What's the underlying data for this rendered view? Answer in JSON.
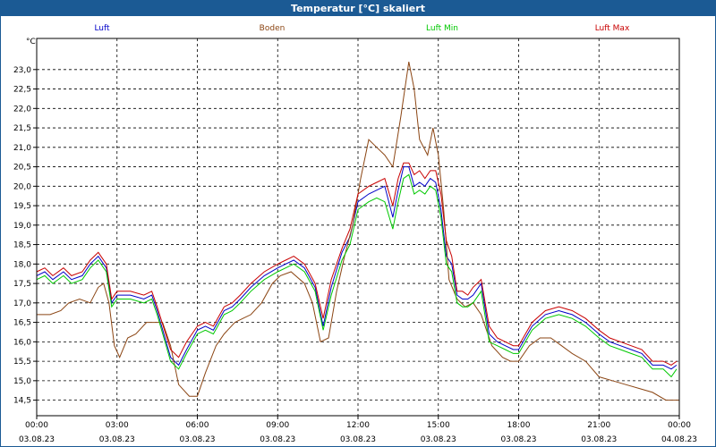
{
  "window": {
    "title": "Temperatur [°C] skaliert"
  },
  "colors": {
    "title_bg": "#1b5a94",
    "grid": "#000000"
  },
  "chart_data": {
    "type": "line",
    "title": "Temperatur [°C] skaliert",
    "ylabel": "°C",
    "ylim": [
      14.1,
      23.8
    ],
    "xlim": [
      "2023-08-03T00:00",
      "2023-08-04T00:00"
    ],
    "yticks": [
      "23,0",
      "22,5",
      "22,0",
      "21,5",
      "21,0",
      "20,5",
      "20,0",
      "19,5",
      "19,0",
      "18,5",
      "18,0",
      "17,5",
      "17,0",
      "16,5",
      "16,0",
      "15,5",
      "15,0",
      "14,5"
    ],
    "xticks": [
      {
        "time": "00:00",
        "date": "03.08.23"
      },
      {
        "time": "03:00",
        "date": "03.08.23"
      },
      {
        "time": "06:00",
        "date": "03.08.23"
      },
      {
        "time": "09:00",
        "date": "03.08.23"
      },
      {
        "time": "12:00",
        "date": "03.08.23"
      },
      {
        "time": "15:00",
        "date": "03.08.23"
      },
      {
        "time": "18:00",
        "date": "03.08.23"
      },
      {
        "time": "21:00",
        "date": "03.08.23"
      },
      {
        "time": "00:00",
        "date": "04.08.23"
      }
    ],
    "grid": true,
    "legend_position": "top",
    "series": [
      {
        "name": "Luft",
        "color": "#0000c8",
        "points": [
          [
            0,
            17.7
          ],
          [
            0.3,
            17.8
          ],
          [
            0.6,
            17.6
          ],
          [
            1,
            17.8
          ],
          [
            1.3,
            17.6
          ],
          [
            1.7,
            17.7
          ],
          [
            2,
            18.0
          ],
          [
            2.3,
            18.2
          ],
          [
            2.6,
            17.9
          ],
          [
            2.8,
            17.0
          ],
          [
            3.0,
            17.2
          ],
          [
            3.5,
            17.2
          ],
          [
            4.0,
            17.1
          ],
          [
            4.3,
            17.2
          ],
          [
            4.5,
            16.8
          ],
          [
            5.0,
            15.6
          ],
          [
            5.3,
            15.4
          ],
          [
            5.6,
            15.8
          ],
          [
            6.0,
            16.3
          ],
          [
            6.3,
            16.4
          ],
          [
            6.6,
            16.3
          ],
          [
            7.0,
            16.8
          ],
          [
            7.3,
            16.9
          ],
          [
            7.6,
            17.1
          ],
          [
            8.0,
            17.4
          ],
          [
            8.5,
            17.7
          ],
          [
            9.0,
            17.9
          ],
          [
            9.3,
            18.0
          ],
          [
            9.6,
            18.1
          ],
          [
            10.0,
            17.9
          ],
          [
            10.4,
            17.4
          ],
          [
            10.7,
            16.4
          ],
          [
            11.0,
            17.4
          ],
          [
            11.4,
            18.3
          ],
          [
            11.7,
            18.7
          ],
          [
            12.0,
            19.6
          ],
          [
            12.4,
            19.8
          ],
          [
            12.7,
            19.9
          ],
          [
            13.0,
            20.0
          ],
          [
            13.3,
            19.2
          ],
          [
            13.5,
            19.9
          ],
          [
            13.7,
            20.5
          ],
          [
            13.9,
            20.5
          ],
          [
            14.1,
            20.0
          ],
          [
            14.3,
            20.1
          ],
          [
            14.5,
            20.0
          ],
          [
            14.7,
            20.2
          ],
          [
            14.9,
            20.1
          ],
          [
            15.1,
            19.4
          ],
          [
            15.3,
            18.2
          ],
          [
            15.5,
            18.0
          ],
          [
            15.7,
            17.2
          ],
          [
            15.9,
            17.1
          ],
          [
            16.1,
            17.1
          ],
          [
            16.3,
            17.2
          ],
          [
            16.6,
            17.5
          ],
          [
            16.9,
            16.2
          ],
          [
            17.2,
            16.0
          ],
          [
            17.5,
            15.9
          ],
          [
            17.8,
            15.8
          ],
          [
            18.0,
            15.8
          ],
          [
            18.5,
            16.4
          ],
          [
            19.0,
            16.7
          ],
          [
            19.5,
            16.8
          ],
          [
            20.0,
            16.7
          ],
          [
            20.5,
            16.5
          ],
          [
            21.0,
            16.2
          ],
          [
            21.4,
            16.0
          ],
          [
            21.8,
            15.9
          ],
          [
            22.2,
            15.8
          ],
          [
            22.6,
            15.7
          ],
          [
            23.0,
            15.4
          ],
          [
            23.4,
            15.4
          ],
          [
            23.7,
            15.3
          ],
          [
            23.9,
            15.4
          ]
        ]
      },
      {
        "name": "Boden",
        "color": "#8b4513",
        "points": [
          [
            0,
            16.7
          ],
          [
            0.5,
            16.7
          ],
          [
            0.9,
            16.8
          ],
          [
            1.2,
            17.0
          ],
          [
            1.6,
            17.1
          ],
          [
            2.0,
            17.0
          ],
          [
            2.3,
            17.4
          ],
          [
            2.5,
            17.5
          ],
          [
            2.7,
            17.0
          ],
          [
            2.9,
            15.9
          ],
          [
            3.1,
            15.6
          ],
          [
            3.4,
            16.1
          ],
          [
            3.7,
            16.2
          ],
          [
            4.1,
            16.5
          ],
          [
            4.4,
            16.5
          ],
          [
            4.7,
            16.5
          ],
          [
            5.0,
            15.9
          ],
          [
            5.3,
            14.9
          ],
          [
            5.7,
            14.6
          ],
          [
            6.0,
            14.6
          ],
          [
            6.3,
            15.2
          ],
          [
            6.7,
            15.9
          ],
          [
            7.0,
            16.2
          ],
          [
            7.4,
            16.5
          ],
          [
            7.7,
            16.6
          ],
          [
            8.0,
            16.7
          ],
          [
            8.4,
            17.0
          ],
          [
            8.8,
            17.5
          ],
          [
            9.1,
            17.7
          ],
          [
            9.5,
            17.8
          ],
          [
            10.0,
            17.5
          ],
          [
            10.3,
            17.0
          ],
          [
            10.6,
            16.0
          ],
          [
            10.9,
            16.1
          ],
          [
            11.2,
            17.3
          ],
          [
            11.5,
            18.2
          ],
          [
            11.8,
            19.0
          ],
          [
            12.1,
            20.2
          ],
          [
            12.4,
            21.2
          ],
          [
            12.7,
            21.0
          ],
          [
            13.0,
            20.8
          ],
          [
            13.3,
            20.5
          ],
          [
            13.6,
            21.8
          ],
          [
            13.9,
            23.2
          ],
          [
            14.1,
            22.5
          ],
          [
            14.3,
            21.2
          ],
          [
            14.6,
            20.8
          ],
          [
            14.8,
            21.5
          ],
          [
            15.0,
            20.8
          ],
          [
            15.2,
            19.4
          ],
          [
            15.4,
            17.6
          ],
          [
            15.7,
            17.1
          ],
          [
            16.0,
            16.9
          ],
          [
            16.3,
            17.0
          ],
          [
            16.6,
            16.7
          ],
          [
            16.8,
            16.3
          ],
          [
            17.0,
            15.9
          ],
          [
            17.4,
            15.6
          ],
          [
            17.7,
            15.5
          ],
          [
            18.0,
            15.5
          ],
          [
            18.4,
            15.9
          ],
          [
            18.8,
            16.1
          ],
          [
            19.2,
            16.1
          ],
          [
            19.6,
            15.9
          ],
          [
            20.0,
            15.7
          ],
          [
            20.5,
            15.5
          ],
          [
            21.0,
            15.1
          ],
          [
            21.5,
            15.0
          ],
          [
            22.0,
            14.9
          ],
          [
            22.5,
            14.8
          ],
          [
            23.0,
            14.7
          ],
          [
            23.5,
            14.5
          ],
          [
            24.0,
            14.5
          ]
        ]
      },
      {
        "name": "Luft Min",
        "color": "#00c800",
        "points": [
          [
            0,
            17.6
          ],
          [
            0.3,
            17.7
          ],
          [
            0.6,
            17.5
          ],
          [
            1,
            17.7
          ],
          [
            1.3,
            17.5
          ],
          [
            1.7,
            17.6
          ],
          [
            2.0,
            17.9
          ],
          [
            2.3,
            18.1
          ],
          [
            2.6,
            17.8
          ],
          [
            2.8,
            16.9
          ],
          [
            3.0,
            17.1
          ],
          [
            3.5,
            17.1
          ],
          [
            4.0,
            17.0
          ],
          [
            4.3,
            17.1
          ],
          [
            4.5,
            16.7
          ],
          [
            5.0,
            15.5
          ],
          [
            5.3,
            15.3
          ],
          [
            5.6,
            15.7
          ],
          [
            6.0,
            16.2
          ],
          [
            6.3,
            16.3
          ],
          [
            6.6,
            16.2
          ],
          [
            7.0,
            16.7
          ],
          [
            7.3,
            16.8
          ],
          [
            7.6,
            17.0
          ],
          [
            8.0,
            17.3
          ],
          [
            8.5,
            17.6
          ],
          [
            9.0,
            17.8
          ],
          [
            9.3,
            17.9
          ],
          [
            9.6,
            18.0
          ],
          [
            10.0,
            17.8
          ],
          [
            10.4,
            17.3
          ],
          [
            10.7,
            16.3
          ],
          [
            11.0,
            17.2
          ],
          [
            11.4,
            18.1
          ],
          [
            11.7,
            18.5
          ],
          [
            12.0,
            19.4
          ],
          [
            12.4,
            19.6
          ],
          [
            12.7,
            19.7
          ],
          [
            13.0,
            19.6
          ],
          [
            13.3,
            18.9
          ],
          [
            13.5,
            19.6
          ],
          [
            13.7,
            20.2
          ],
          [
            13.9,
            20.3
          ],
          [
            14.1,
            19.8
          ],
          [
            14.3,
            19.9
          ],
          [
            14.5,
            19.8
          ],
          [
            14.7,
            20.0
          ],
          [
            14.9,
            19.9
          ],
          [
            15.1,
            19.2
          ],
          [
            15.3,
            18.0
          ],
          [
            15.5,
            17.8
          ],
          [
            15.7,
            17.0
          ],
          [
            15.9,
            16.9
          ],
          [
            16.1,
            16.9
          ],
          [
            16.3,
            17.0
          ],
          [
            16.6,
            17.3
          ],
          [
            16.9,
            16.0
          ],
          [
            17.2,
            15.9
          ],
          [
            17.5,
            15.8
          ],
          [
            17.8,
            15.7
          ],
          [
            18.0,
            15.7
          ],
          [
            18.5,
            16.3
          ],
          [
            19.0,
            16.6
          ],
          [
            19.5,
            16.7
          ],
          [
            20.0,
            16.6
          ],
          [
            20.5,
            16.4
          ],
          [
            21.0,
            16.1
          ],
          [
            21.4,
            15.9
          ],
          [
            21.8,
            15.8
          ],
          [
            22.2,
            15.7
          ],
          [
            22.6,
            15.6
          ],
          [
            23.0,
            15.3
          ],
          [
            23.4,
            15.3
          ],
          [
            23.7,
            15.1
          ],
          [
            23.9,
            15.3
          ]
        ]
      },
      {
        "name": "Luft Max",
        "color": "#c80000",
        "points": [
          [
            0,
            17.8
          ],
          [
            0.3,
            17.9
          ],
          [
            0.6,
            17.7
          ],
          [
            1,
            17.9
          ],
          [
            1.3,
            17.7
          ],
          [
            1.7,
            17.8
          ],
          [
            2.0,
            18.1
          ],
          [
            2.3,
            18.3
          ],
          [
            2.6,
            18.0
          ],
          [
            2.8,
            17.1
          ],
          [
            3.0,
            17.3
          ],
          [
            3.5,
            17.3
          ],
          [
            4.0,
            17.2
          ],
          [
            4.3,
            17.3
          ],
          [
            4.5,
            16.9
          ],
          [
            5.0,
            15.8
          ],
          [
            5.3,
            15.6
          ],
          [
            5.6,
            16.0
          ],
          [
            6.0,
            16.4
          ],
          [
            6.3,
            16.5
          ],
          [
            6.6,
            16.4
          ],
          [
            7.0,
            16.9
          ],
          [
            7.3,
            17.0
          ],
          [
            7.6,
            17.2
          ],
          [
            8.0,
            17.5
          ],
          [
            8.5,
            17.8
          ],
          [
            9.0,
            18.0
          ],
          [
            9.3,
            18.1
          ],
          [
            9.6,
            18.2
          ],
          [
            10.0,
            18.0
          ],
          [
            10.4,
            17.5
          ],
          [
            10.7,
            16.6
          ],
          [
            11.0,
            17.6
          ],
          [
            11.4,
            18.4
          ],
          [
            11.7,
            18.9
          ],
          [
            12.0,
            19.8
          ],
          [
            12.4,
            20.0
          ],
          [
            12.7,
            20.1
          ],
          [
            13.0,
            20.2
          ],
          [
            13.3,
            19.5
          ],
          [
            13.5,
            20.2
          ],
          [
            13.7,
            20.6
          ],
          [
            13.9,
            20.6
          ],
          [
            14.1,
            20.3
          ],
          [
            14.3,
            20.4
          ],
          [
            14.5,
            20.2
          ],
          [
            14.7,
            20.4
          ],
          [
            14.9,
            20.4
          ],
          [
            15.1,
            19.8
          ],
          [
            15.3,
            18.6
          ],
          [
            15.5,
            18.2
          ],
          [
            15.7,
            17.3
          ],
          [
            15.9,
            17.3
          ],
          [
            16.1,
            17.2
          ],
          [
            16.3,
            17.4
          ],
          [
            16.6,
            17.6
          ],
          [
            16.9,
            16.4
          ],
          [
            17.2,
            16.1
          ],
          [
            17.5,
            16.0
          ],
          [
            17.8,
            15.9
          ],
          [
            18.0,
            15.9
          ],
          [
            18.5,
            16.5
          ],
          [
            19.0,
            16.8
          ],
          [
            19.5,
            16.9
          ],
          [
            20.0,
            16.8
          ],
          [
            20.5,
            16.6
          ],
          [
            21.0,
            16.3
          ],
          [
            21.4,
            16.1
          ],
          [
            21.8,
            16.0
          ],
          [
            22.2,
            15.9
          ],
          [
            22.6,
            15.8
          ],
          [
            23.0,
            15.5
          ],
          [
            23.4,
            15.5
          ],
          [
            23.7,
            15.4
          ],
          [
            23.9,
            15.5
          ]
        ]
      }
    ]
  }
}
